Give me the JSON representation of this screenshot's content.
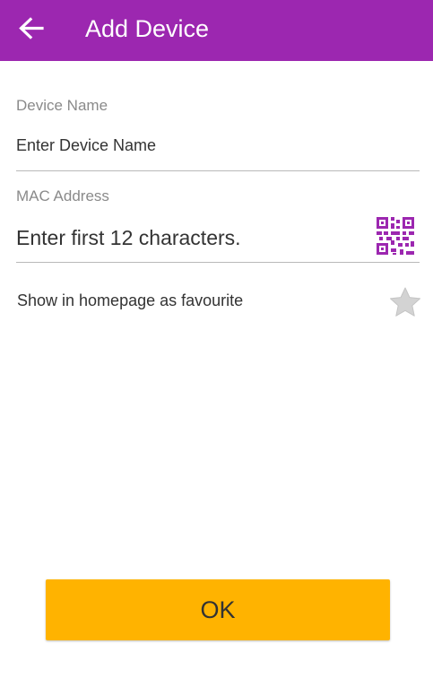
{
  "colors": {
    "app_bar": "#9c27b0",
    "accent": "#9c27b0",
    "ok_button": "#ffb300",
    "star_inactive": "#d3d3d3"
  },
  "app_bar": {
    "back_icon": "arrow-left-icon",
    "title": "Add Device"
  },
  "device_name": {
    "label": "Device Name",
    "placeholder": "Enter Device Name",
    "value": ""
  },
  "mac_address": {
    "label": "MAC Address",
    "placeholder": "Enter first 12 characters.",
    "value": "",
    "scan_icon": "qr-code-icon"
  },
  "favourite": {
    "label": "Show in homepage as favourite",
    "icon": "star-icon",
    "checked": false
  },
  "ok_button": {
    "label": "OK"
  }
}
